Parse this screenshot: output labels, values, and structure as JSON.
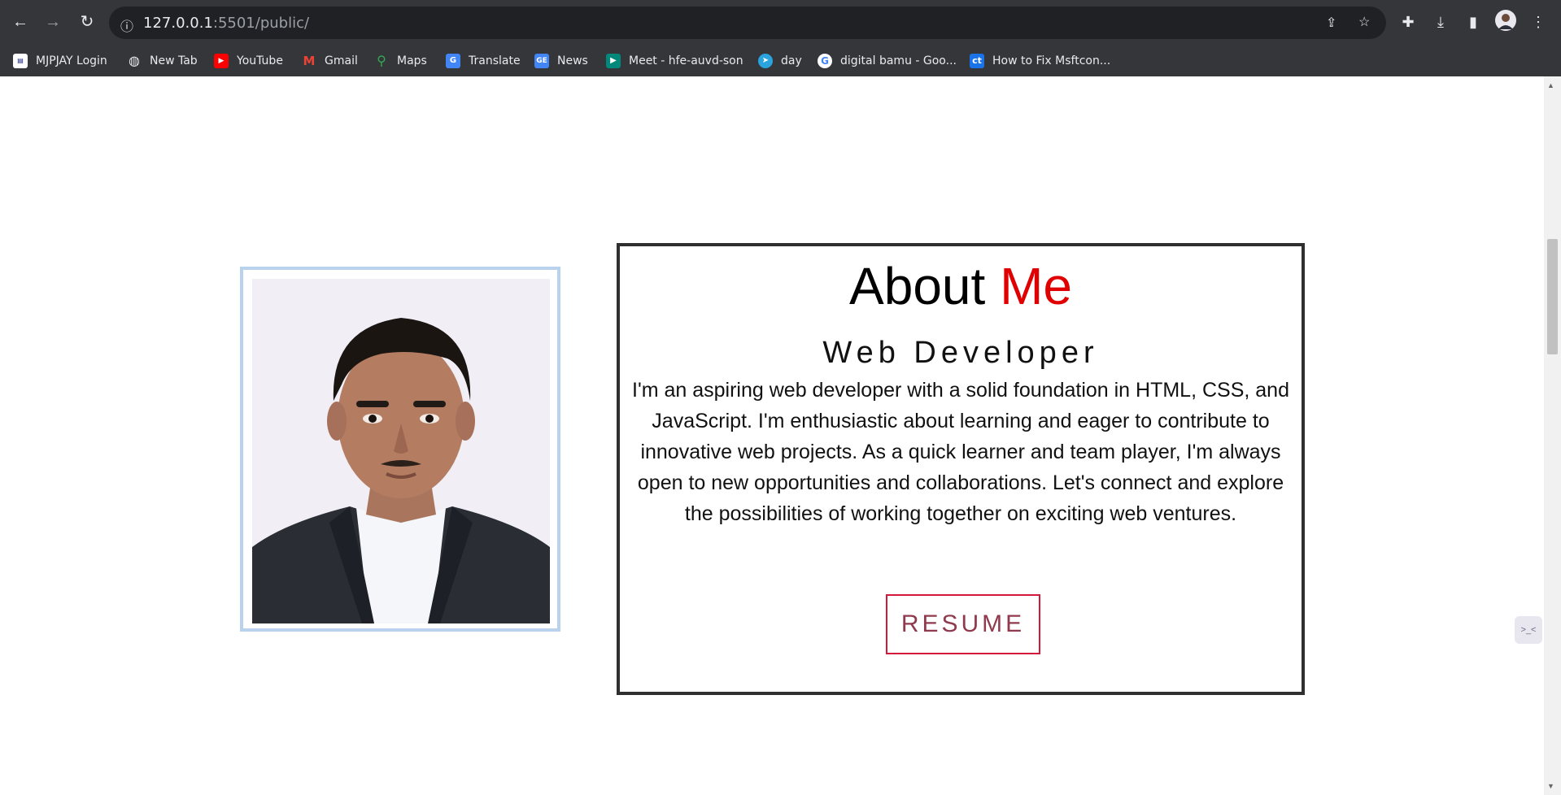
{
  "browser": {
    "url_host": "127.0.0.1",
    "url_rest": ":5501/public/",
    "bookmarks": [
      {
        "label": "MJPJAY Login",
        "icon": "mjpjay-favicon",
        "color": "#ffffff"
      },
      {
        "label": "New Tab",
        "icon": "globe-icon",
        "color": "#e8eaed"
      },
      {
        "label": "YouTube",
        "icon": "youtube-icon",
        "color": "#ff0000"
      },
      {
        "label": "Gmail",
        "icon": "gmail-icon",
        "color": "#ea4335"
      },
      {
        "label": "Maps",
        "icon": "maps-icon",
        "color": "#34a853"
      },
      {
        "label": "Translate",
        "icon": "translate-icon",
        "color": "#4285f4"
      },
      {
        "label": "News",
        "icon": "news-icon",
        "color": "#4285f4"
      },
      {
        "label": "Meet - hfe-auvd-son",
        "icon": "meet-icon",
        "color": "#00897b"
      },
      {
        "label": "day",
        "icon": "telegram-icon",
        "color": "#2aa3de"
      },
      {
        "label": "digital bamu - Goo...",
        "icon": "google-icon",
        "color": "#ffffff"
      },
      {
        "label": "How to Fix Msftcon...",
        "icon": "ct-icon",
        "color": "#1a73e8"
      }
    ]
  },
  "about": {
    "title_part1": "About",
    "title_part2": "Me",
    "subtitle": "Web Developer",
    "paragraph": "I'm an aspiring web developer with a solid foundation in HTML, CSS, and JavaScript. I'm enthusiastic about learning and eager to contribute to innovative web projects. As a quick learner and team player, I'm always open to new opportunities and collaborations. Let's connect and explore the possibilities of working together on exciting web ventures.",
    "resume_label": "RESUME"
  },
  "colors": {
    "accent_red": "#e00000",
    "resume_border": "#d4193d",
    "photo_frame": "#b9d3ef"
  }
}
